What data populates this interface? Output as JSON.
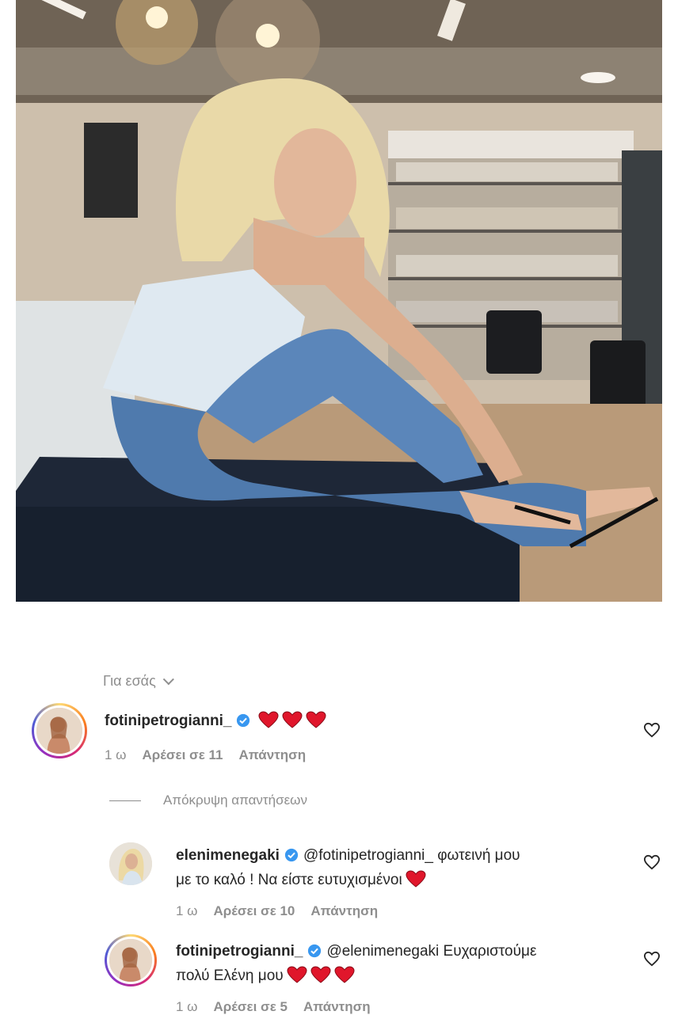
{
  "comments_header": {
    "filter_label": "Για εσάς",
    "filter_icon": "chevron-down-icon"
  },
  "comments": [
    {
      "username": "fotinipetrogianni_",
      "verified": true,
      "text": "",
      "emoji": [
        "red-heart",
        "red-heart",
        "red-heart"
      ],
      "time": "1 ω",
      "likes": "Αρέσει σε 11",
      "reply": "Απάντηση"
    }
  ],
  "hide_replies_label": "Απόκρυψη απαντήσεων",
  "replies": [
    {
      "username": "elenimenegaki",
      "verified": true,
      "text_line1": "@fotinipetrogianni_ φωτεινή μου",
      "text_line2": "με το καλό ! Να είστε ευτυχισμένοι",
      "emoji": [
        "red-heart"
      ],
      "time": "1 ω",
      "likes": "Αρέσει σε 10",
      "reply": "Απάντηση"
    },
    {
      "username": "fotinipetrogianni_",
      "verified": true,
      "text_line1": "@elenimenegaki Ευχαριστούμε",
      "text_line2": "πολύ Ελένη μου",
      "emoji": [
        "red-heart",
        "red-heart",
        "red-heart"
      ],
      "time": "1 ω",
      "likes": "Αρέσει σε 5",
      "reply": "Απάντηση"
    }
  ],
  "colors": {
    "meta_gray": "#8e8e8e",
    "text_dark": "#262626",
    "verified_blue": "#3897f0",
    "heart_red": "#e0162b"
  }
}
